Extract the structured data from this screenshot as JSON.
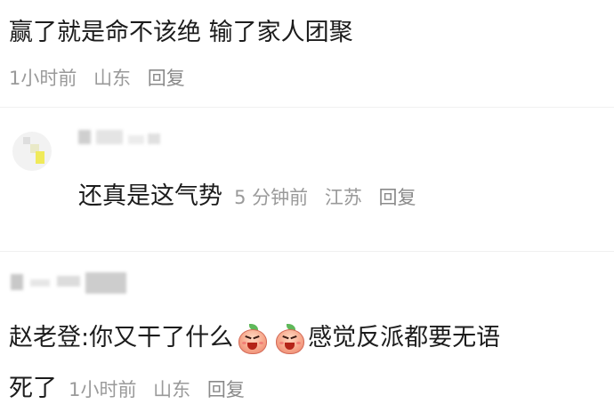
{
  "comments": [
    {
      "text": "赢了就是命不该绝 输了家人团聚",
      "time": "1小时前",
      "location": "山东",
      "reply": "回复"
    },
    {
      "text": "还真是这气势",
      "time": "5 分钟前",
      "location": "江苏",
      "reply": "回复"
    },
    {
      "text_prefix": "赵老登:你又干了什么",
      "text_suffix": "感觉反派都要无语",
      "text_line2": "死了",
      "time": "1小时前",
      "location": "山东",
      "reply": "回复",
      "emojis": [
        "laughing-peach-icon",
        "laughing-peach-icon"
      ]
    }
  ],
  "colors": {
    "text": "#1c1c1c",
    "meta": "#9a9a9a",
    "emoji": "#f7a88c"
  }
}
